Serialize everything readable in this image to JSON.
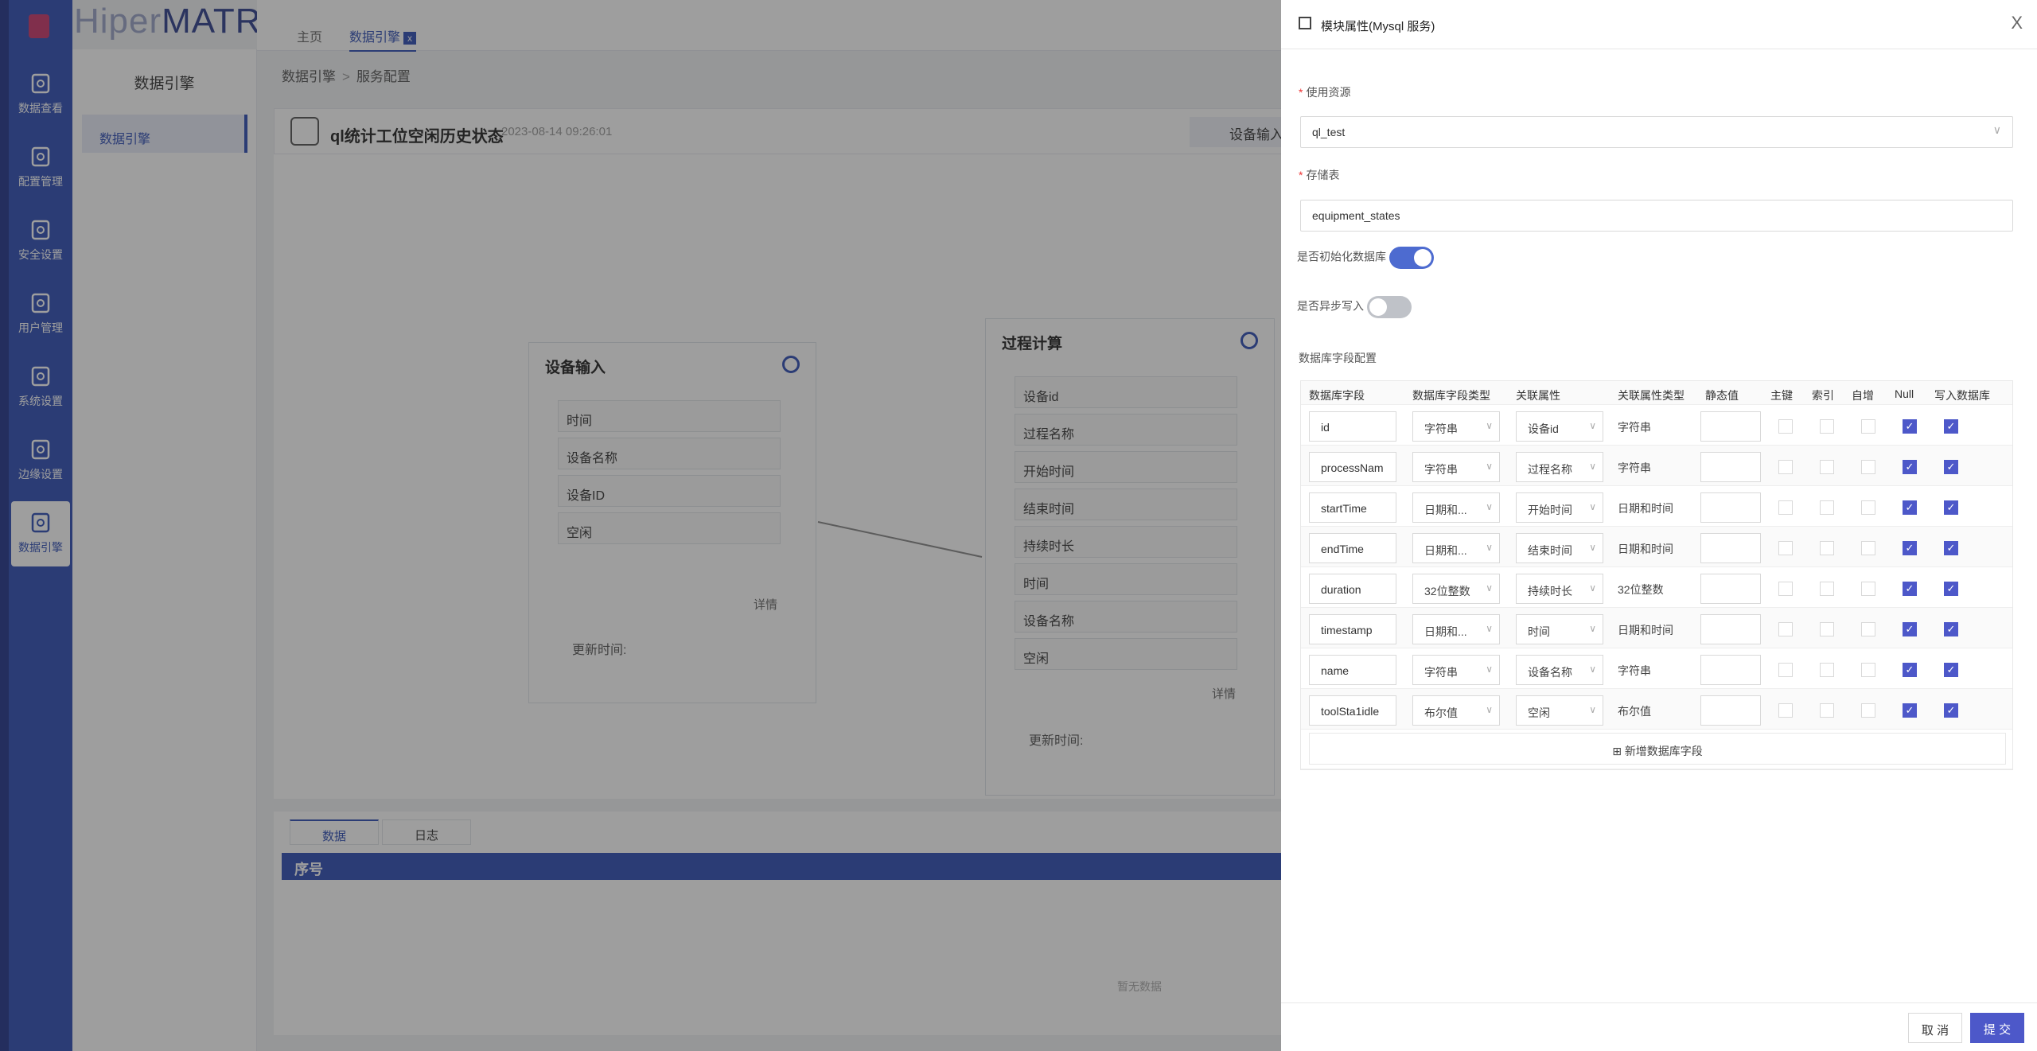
{
  "brand": {
    "prefix": "Hiper",
    "name": "MATRIX"
  },
  "nav": {
    "items": [
      {
        "label": "数据查看",
        "icon": "cube-icon"
      },
      {
        "label": "配置管理",
        "icon": "document-icon"
      },
      {
        "label": "安全设置",
        "icon": "house-shield-icon"
      },
      {
        "label": "用户管理",
        "icon": "shield-user-icon"
      },
      {
        "label": "系统设置",
        "icon": "settings-list-icon"
      },
      {
        "label": "边缘设置",
        "icon": "edge-nodes-icon"
      },
      {
        "label": "数据引擎",
        "icon": "data-engine-icon",
        "active": true
      }
    ]
  },
  "subnav": {
    "title": "数据引擎",
    "item": "数据引擎"
  },
  "tabs": {
    "home": "主页",
    "current": "数据引擎",
    "close": "x"
  },
  "breadcrumb": {
    "a": "数据引擎",
    "sep": ">",
    "b": "服务配置"
  },
  "flow": {
    "name": "ql统计工位空闲历史状态",
    "time": "2023-08-14 09:26:01",
    "input_btn": "设备输入"
  },
  "node_input": {
    "title": "设备输入",
    "fields": [
      "时间",
      "设备名称",
      "设备ID",
      "空闲"
    ],
    "detail": "详情",
    "updated": "更新时间:"
  },
  "node_calc": {
    "title": "过程计算",
    "fields": [
      "设备id",
      "过程名称",
      "开始时间",
      "结束时间",
      "持续时长",
      "时间",
      "设备名称",
      "空闲"
    ],
    "detail": "详情",
    "updated": "更新时间:"
  },
  "bottom": {
    "tab_data": "数据",
    "tab_log": "日志",
    "col_index": "序号",
    "empty": "暂无数据"
  },
  "drawer": {
    "title": "模块属性(Mysql 服务)",
    "close": "X",
    "resource_label": "使用资源",
    "resource_value": "ql_test",
    "table_label": "存储表",
    "table_value": "equipment_states",
    "init_db_label": "是否初始化数据库",
    "init_db": true,
    "async_label": "是否异步写入",
    "async": false,
    "fields_label": "数据库字段配置",
    "columns": [
      "数据库字段",
      "数据库字段类型",
      "关联属性",
      "关联属性类型",
      "静态值",
      "主键",
      "索引",
      "自增",
      "Null",
      "写入数据库"
    ],
    "rows": [
      {
        "field": "id",
        "type": "字符串",
        "attr": "设备id",
        "attr_type": "字符串",
        "pk": false,
        "idx": false,
        "ai": false,
        "null": true,
        "write": true
      },
      {
        "field": "processNam",
        "type": "字符串",
        "attr": "过程名称",
        "attr_type": "字符串",
        "pk": false,
        "idx": false,
        "ai": false,
        "null": true,
        "write": true
      },
      {
        "field": "startTime",
        "type": "日期和...",
        "attr": "开始时间",
        "attr_type": "日期和时间",
        "pk": false,
        "idx": false,
        "ai": false,
        "null": true,
        "write": true
      },
      {
        "field": "endTime",
        "type": "日期和...",
        "attr": "结束时间",
        "attr_type": "日期和时间",
        "pk": false,
        "idx": false,
        "ai": false,
        "null": true,
        "write": true
      },
      {
        "field": "duration",
        "type": "32位整数",
        "attr": "持续时长",
        "attr_type": "32位整数",
        "pk": false,
        "idx": false,
        "ai": false,
        "null": true,
        "write": true
      },
      {
        "field": "timestamp",
        "type": "日期和...",
        "attr": "时间",
        "attr_type": "日期和时间",
        "pk": false,
        "idx": false,
        "ai": false,
        "null": true,
        "write": true
      },
      {
        "field": "name",
        "type": "字符串",
        "attr": "设备名称",
        "attr_type": "字符串",
        "pk": false,
        "idx": false,
        "ai": false,
        "null": true,
        "write": true
      },
      {
        "field": "toolSta1idle",
        "type": "布尔值",
        "attr": "空闲",
        "attr_type": "布尔值",
        "pk": false,
        "idx": false,
        "ai": false,
        "null": true,
        "write": true
      }
    ],
    "add_field": "新增数据库字段",
    "cancel": "取 消",
    "submit": "提 交"
  },
  "colors": {
    "primary": "#2f4eb5",
    "accent": "#4d58c9",
    "required": "#e33333"
  }
}
